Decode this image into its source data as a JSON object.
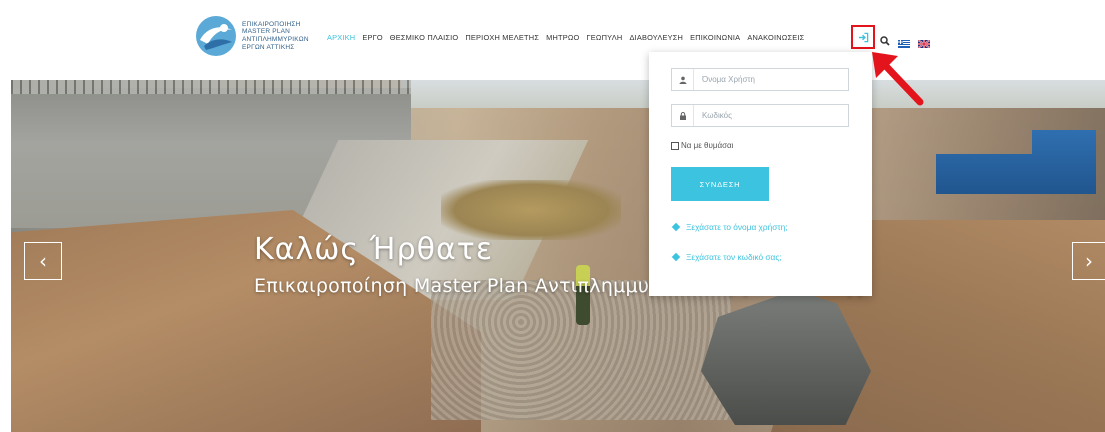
{
  "brand": {
    "logo_lines": [
      "ΕΠΙΚΑΙΡΟΠΟΙΗΣΗ",
      "MASTER PLAN",
      "ΑΝΤΙΠΛΗΜΜΥΡΙΚΩΝ",
      "ΕΡΓΩΝ ΑΤΤΙΚΗΣ"
    ],
    "accent": "#3cc3df",
    "logo_color": "#2f5f8a"
  },
  "nav": {
    "items": [
      "ΑΡΧΙΚΗ",
      "ΕΡΓΟ",
      "ΘΕΣΜΙΚΟ ΠΛΑΙΣΙΟ",
      "ΠΕΡΙΟΧΗ ΜΕΛΕΤΗΣ",
      "ΜΗΤΡΩΟ",
      "ΓΕΩΠΥΛΗ",
      "ΔΙΑΒΟΥΛΕΥΣΗ",
      "ΕΠΙΚΟΙΝΩΝΙΑ",
      "ΑΝΑΚΟΙΝΩΣΕΙΣ"
    ],
    "active_index": 0
  },
  "tools": {
    "login_icon": "sign-in-icon",
    "search_icon": "search-icon",
    "flags": [
      "greek-flag-icon",
      "uk-flag-icon"
    ],
    "highlight_color": "#e3141b"
  },
  "hero": {
    "title": "Καλώς Ήρθατε",
    "subtitle": "Επικαιροποίηση Master Plan Αντιπλημμυρικών Έργων Αττικής",
    "prev": "‹",
    "next": "›"
  },
  "login": {
    "username_placeholder": "Όνομα Χρήστη",
    "password_placeholder": "Κωδικός",
    "remember_label": "Να με θυμάσαι",
    "submit_label": "ΣΥΝΔΕΣΗ",
    "forgot_username": "Ξεχάσατε το όνομα χρήστη;",
    "forgot_password": "Ξεχάσατε τον κωδικό σας;"
  }
}
